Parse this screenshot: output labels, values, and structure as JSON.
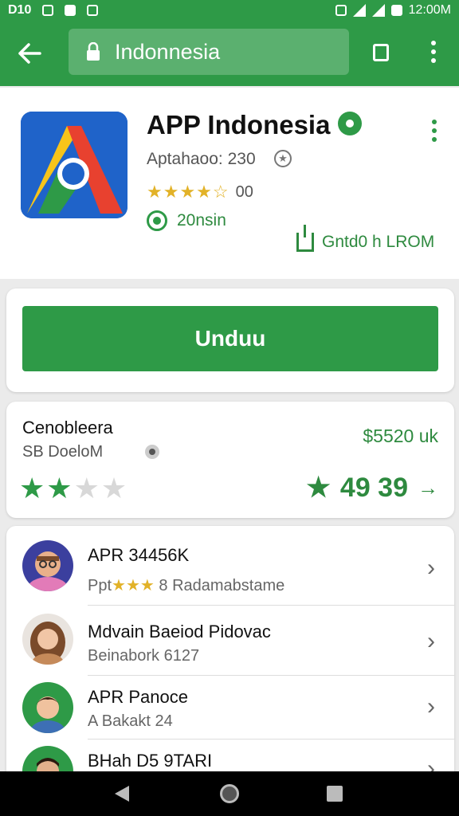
{
  "status_bar": {
    "left_text": "D10",
    "time": "12:00M",
    "icons": [
      "sim-icon",
      "notification-icon",
      "cast-icon",
      "wifi-icon",
      "signal-icon",
      "battery-icon"
    ]
  },
  "app_bar": {
    "url_text": "Indonnesia",
    "icons": [
      "back-arrow-icon",
      "lock-icon",
      "tab-switcher-icon",
      "overflow-menu-icon"
    ]
  },
  "app": {
    "title": "APP Indonesia",
    "developer": "Aptahaoo: 230",
    "rating_stars": "★★★★☆",
    "rating_text": "00",
    "rating_value": 4,
    "installs": "20nsin",
    "size_text": "Gntd0 h LROM"
  },
  "download": {
    "label": "Unduu"
  },
  "review_card": {
    "title": "Cenobleera",
    "subtitle": "SB DoeloM",
    "price": "$5520 uk",
    "stars_filled": 2,
    "stars_total": 4,
    "score": "49 39",
    "arrow": "→"
  },
  "list": [
    {
      "title": "APR 34456K",
      "sub_prefix": "Ppt",
      "sub_stars": "★★★",
      "sub_text": "8 Radamabstame",
      "avatar": "avatar-man-glasses"
    },
    {
      "title": "Mdvain Baeiod Pidovac",
      "sub_prefix": "",
      "sub_stars": "",
      "sub_text": "Beinabork 6127",
      "avatar": "avatar-woman"
    },
    {
      "title": "APR Panoce",
      "sub_prefix": "",
      "sub_stars": "",
      "sub_text": "A Bakakt 24",
      "avatar": "avatar-boy"
    },
    {
      "title": "BHah D5 9TARI",
      "sub_prefix": "",
      "sub_stars": "",
      "sub_text": "",
      "avatar": "avatar-man"
    }
  ],
  "colors": {
    "primary": "#2e9a47",
    "star_gold": "#e2b228",
    "nav_bar": "#000000"
  }
}
